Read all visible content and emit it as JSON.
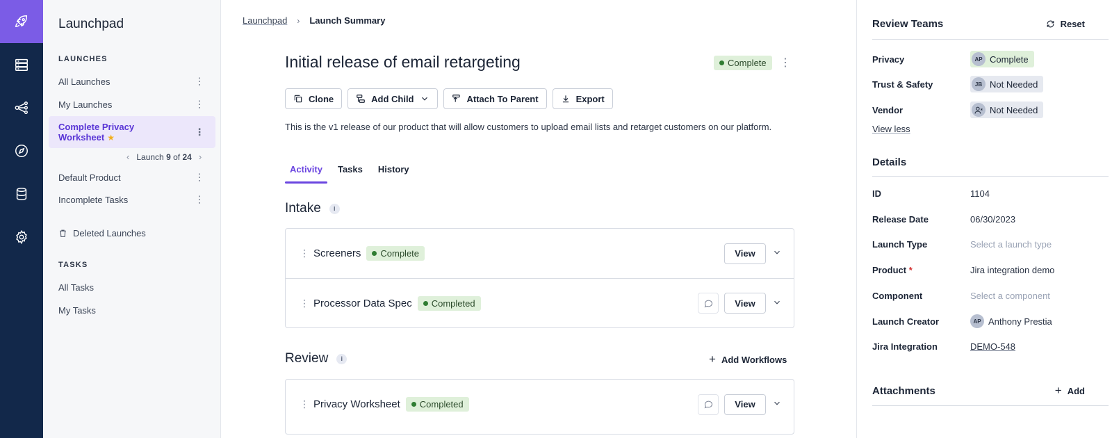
{
  "app": {
    "title": "Launchpad"
  },
  "rail": {
    "items": [
      {
        "icon": "rocket-icon"
      },
      {
        "icon": "server-icon"
      },
      {
        "icon": "workflow-icon"
      },
      {
        "icon": "compass-icon"
      },
      {
        "icon": "database-icon"
      },
      {
        "icon": "gear-icon"
      }
    ],
    "active_color": "#7b5ce6",
    "background": "#12284a"
  },
  "sidebar": {
    "launches_label": "LAUNCHES",
    "launch_items": [
      {
        "label": "All Launches"
      },
      {
        "label": "My Launches"
      },
      {
        "label": "Complete Privacy Worksheet",
        "starred": true
      },
      {
        "label": "Default Product"
      },
      {
        "label": "Incomplete Tasks"
      }
    ],
    "pager": {
      "prefix": "Launch",
      "current": "9",
      "of": "of",
      "total": "24"
    },
    "deleted_label": "Deleted Launches",
    "tasks_label": "TASKS",
    "task_items": [
      {
        "label": "All Tasks"
      },
      {
        "label": "My Tasks"
      }
    ]
  },
  "breadcrumb": {
    "root": "Launchpad",
    "separator": "›",
    "current": "Launch Summary"
  },
  "launch": {
    "title": "Initial release of email retargeting",
    "status": "Complete",
    "description": "This is the v1 release of our product that will allow customers to upload email lists and retarget customers on our platform."
  },
  "actions": {
    "clone": "Clone",
    "add_child": "Add Child",
    "attach_to_parent": "Attach To Parent",
    "export": "Export"
  },
  "tabs": [
    {
      "label": "Activity",
      "active": true
    },
    {
      "label": "Tasks",
      "active": false
    },
    {
      "label": "History",
      "active": false
    }
  ],
  "intake": {
    "title": "Intake",
    "info": "i",
    "rows": [
      {
        "name": "Screeners",
        "status": "Complete",
        "has_comment": false,
        "view": "View"
      },
      {
        "name": "Processor Data Spec",
        "status": "Completed",
        "has_comment": true,
        "view": "View"
      }
    ]
  },
  "review": {
    "title": "Review",
    "info": "i",
    "add_workflows": "Add Workflows",
    "rows": [
      {
        "name": "Privacy Worksheet",
        "status": "Completed",
        "has_comment": true,
        "view": "View"
      }
    ]
  },
  "review_teams": {
    "title": "Review Teams",
    "reset": "Reset",
    "teams": [
      {
        "name": "Privacy",
        "avatar": "AP",
        "status": "Complete",
        "tone": "green"
      },
      {
        "name": "Trust & Safety",
        "avatar": "JB",
        "status": "Not Needed",
        "tone": "grey"
      },
      {
        "name": "Vendor",
        "avatar": "",
        "status": "Not Needed",
        "tone": "grey"
      }
    ],
    "view_less": "View less"
  },
  "details": {
    "title": "Details",
    "id": {
      "label": "ID",
      "value": "1104"
    },
    "release_date": {
      "label": "Release Date",
      "value": "06/30/2023"
    },
    "launch_type": {
      "label": "Launch Type",
      "placeholder": "Select a launch type"
    },
    "product": {
      "label": "Product",
      "required": "*",
      "value": "Jira integration demo"
    },
    "component": {
      "label": "Component",
      "placeholder": "Select a component"
    },
    "launch_creator": {
      "label": "Launch Creator",
      "avatar": "AP",
      "value": "Anthony Prestia"
    },
    "jira_integration": {
      "label": "Jira Integration",
      "value": "DEMO-548"
    }
  },
  "attachments": {
    "title": "Attachments",
    "add": "Add"
  },
  "colors": {
    "accent": "#6a45e0",
    "success_bg": "#dff0da",
    "success_dot": "#2f7d32",
    "neutral_pill": "#e6e9f0"
  }
}
